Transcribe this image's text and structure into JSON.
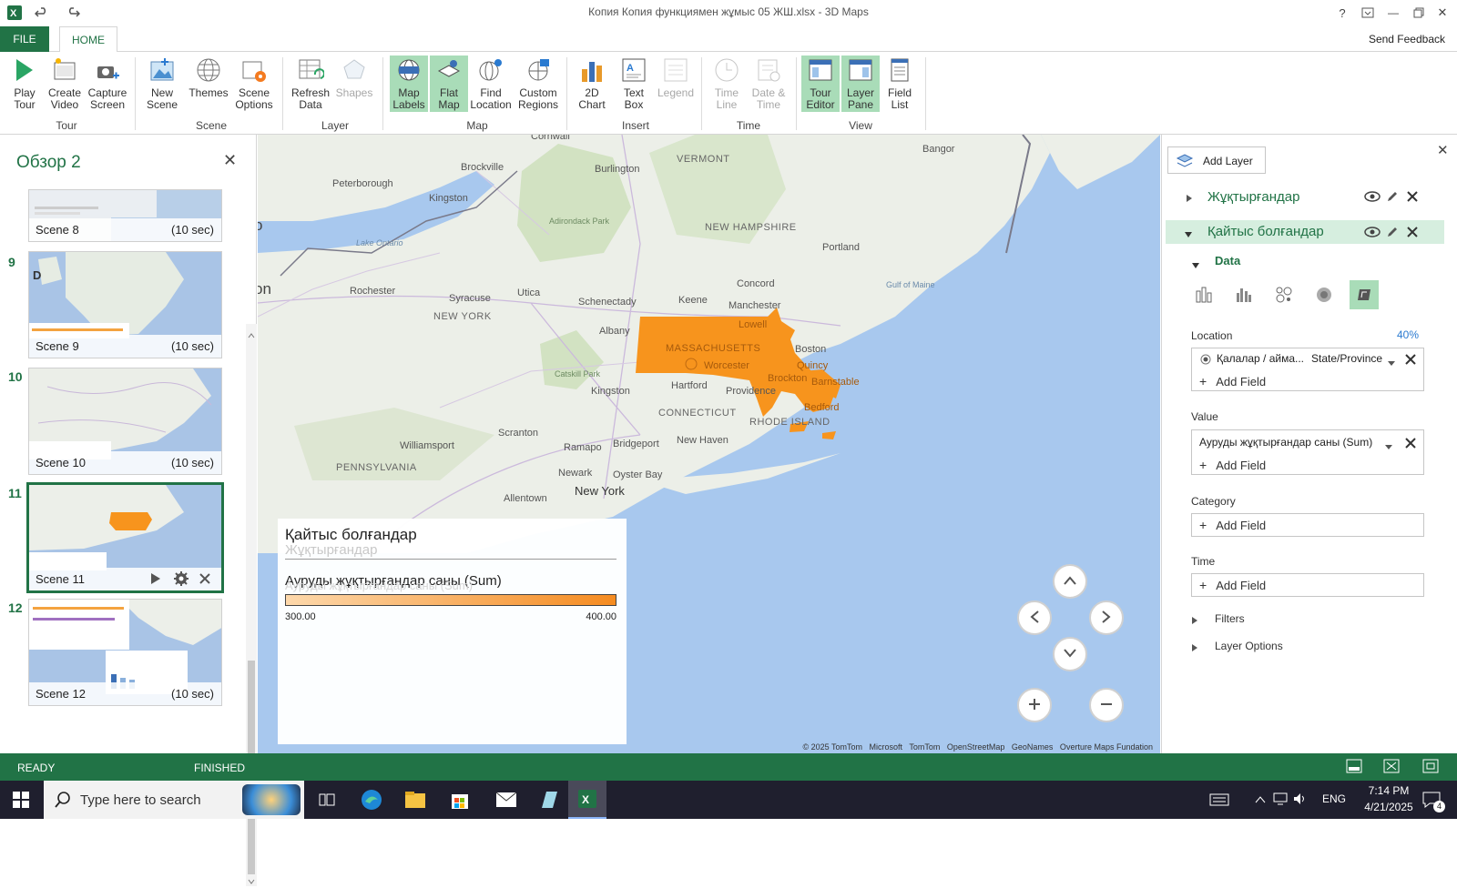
{
  "titlebar": {
    "title": "Копия Копия функциямен жұмыс 05 ЖШ.xlsx - 3D Maps",
    "help": "?",
    "minimize": "—",
    "close": "✕"
  },
  "tabs": {
    "file": "FILE",
    "home": "HOME",
    "feedback": "Send Feedback"
  },
  "ribbon": {
    "play_tour": "Play Tour",
    "create_video": "Create Video",
    "capture_screen": "Capture Screen",
    "group_tour": "Tour",
    "new_scene": "New Scene",
    "themes": "Themes",
    "scene_options": "Scene Options",
    "group_scene": "Scene",
    "refresh_data": "Refresh Data",
    "shapes": "Shapes",
    "group_layer": "Layer",
    "map_labels": "Map Labels",
    "flat_map": "Flat Map",
    "find_location": "Find Location",
    "custom_regions": "Custom Regions",
    "group_map": "Map",
    "chart_2d": "2D Chart",
    "text_box": "Text Box",
    "legend": "Legend",
    "group_insert": "Insert",
    "time_line": "Time Line",
    "date_time": "Date & Time",
    "group_time": "Time",
    "tour_editor": "Tour Editor",
    "layer_pane": "Layer Pane",
    "field_list": "Field List",
    "group_view": "View"
  },
  "tour": {
    "title": "Обзор 2",
    "close": "✕",
    "scenes": [
      {
        "number": "",
        "name": "Scene 8",
        "duration": "(10 sec)"
      },
      {
        "number": "9",
        "name": "Scene 9",
        "duration": "(10 sec)"
      },
      {
        "number": "10",
        "name": "Scene 10",
        "duration": "(10 sec)"
      },
      {
        "number": "11",
        "name": "Scene 11",
        "duration": ""
      },
      {
        "number": "12",
        "name": "Scene 12",
        "duration": "(10 sec)"
      }
    ]
  },
  "map": {
    "labels": {
      "vermont": "VERMONT",
      "new_hampshire": "NEW HAMPSHIRE",
      "new_york_state": "NEW YORK",
      "massachusetts": "MASSACHUSETTS",
      "connecticut": "CONNECTICUT",
      "rhode_island": "RHODE ISLAND",
      "pennsylvania": "PENNSYLVANIA",
      "gulf_of_maine": "Gulf of Maine",
      "lake_ontario": "Lake Ontario",
      "adirondack": "Adirondack Park",
      "catskill": "Catskill Park",
      "brockville": "Brockville",
      "peterborough": "Peterborough",
      "kingston_on": "Kingston",
      "burlington": "Burlington",
      "rochester": "Rochester",
      "syracuse": "Syracuse",
      "utica": "Utica",
      "schenectady": "Schenectady",
      "albany": "Albany",
      "keene": "Keene",
      "concord": "Concord",
      "manchester": "Manchester",
      "lowell": "Lowell",
      "boston": "Boston",
      "worcester": "Worcester",
      "quincy": "Quincy",
      "brockton": "Brockton",
      "providence": "Providence",
      "hartford": "Hartford",
      "new_haven": "New Haven",
      "bridgeport": "Bridgeport",
      "kingston_ny": "Kingston",
      "scranton": "Scranton",
      "williamsport": "Williamsport",
      "ramapo": "Ramapo",
      "newark": "Newark",
      "oyster_bay": "Oyster Bay",
      "new_york_city": "New York",
      "allentown": "Allentown",
      "portland": "Portland",
      "bangor": "Bangor",
      "cornwall": "Cornwall",
      "bedford": "Bedford",
      "barnstable": "Barnstable",
      "ottawa_edge": "on",
      "o_edge": "o"
    },
    "attribution": "© 2025 TomTom   Microsoft   TomTom   OpenStreetMap   GeoNames   Overture Maps Fundation"
  },
  "legend": {
    "title": "Қайтыс болғандар",
    "ghost_title": "Жұқтырғандар",
    "field": "Ауруды жұқтырғандар саны (Sum)",
    "ghost_field": "Ауруды жұқтырғандар саны (Sum)",
    "min": "300.00",
    "max": "400.00",
    "color_min": "#fdd8ab",
    "color_max": "#f58b20"
  },
  "layers": {
    "add_layer": "Add Layer",
    "close": "✕",
    "layer1_name": "Жұқтырғандар",
    "layer2_name": "Қайтыс болғандар",
    "data_section": "Data",
    "location_label": "Location",
    "location_pct": "40%",
    "location_field": "Қалалар / айма...",
    "location_type": "State/Province",
    "add_field": "Add Field",
    "value_label": "Value",
    "value_field": "Ауруды жұқтырғандар саны (Sum)",
    "category_label": "Category",
    "time_label": "Time",
    "filters": "Filters",
    "layer_options": "Layer Options"
  },
  "status": {
    "ready": "READY",
    "finished": "FINISHED"
  },
  "taskbar": {
    "search_placeholder": "Type here to search",
    "language": "ENG",
    "time": "7:14 PM",
    "date": "4/21/2025",
    "notifications": "4"
  },
  "colors": {
    "accent": "#217346",
    "region_fill": "#f7941d",
    "water": "#a8c8ee"
  }
}
